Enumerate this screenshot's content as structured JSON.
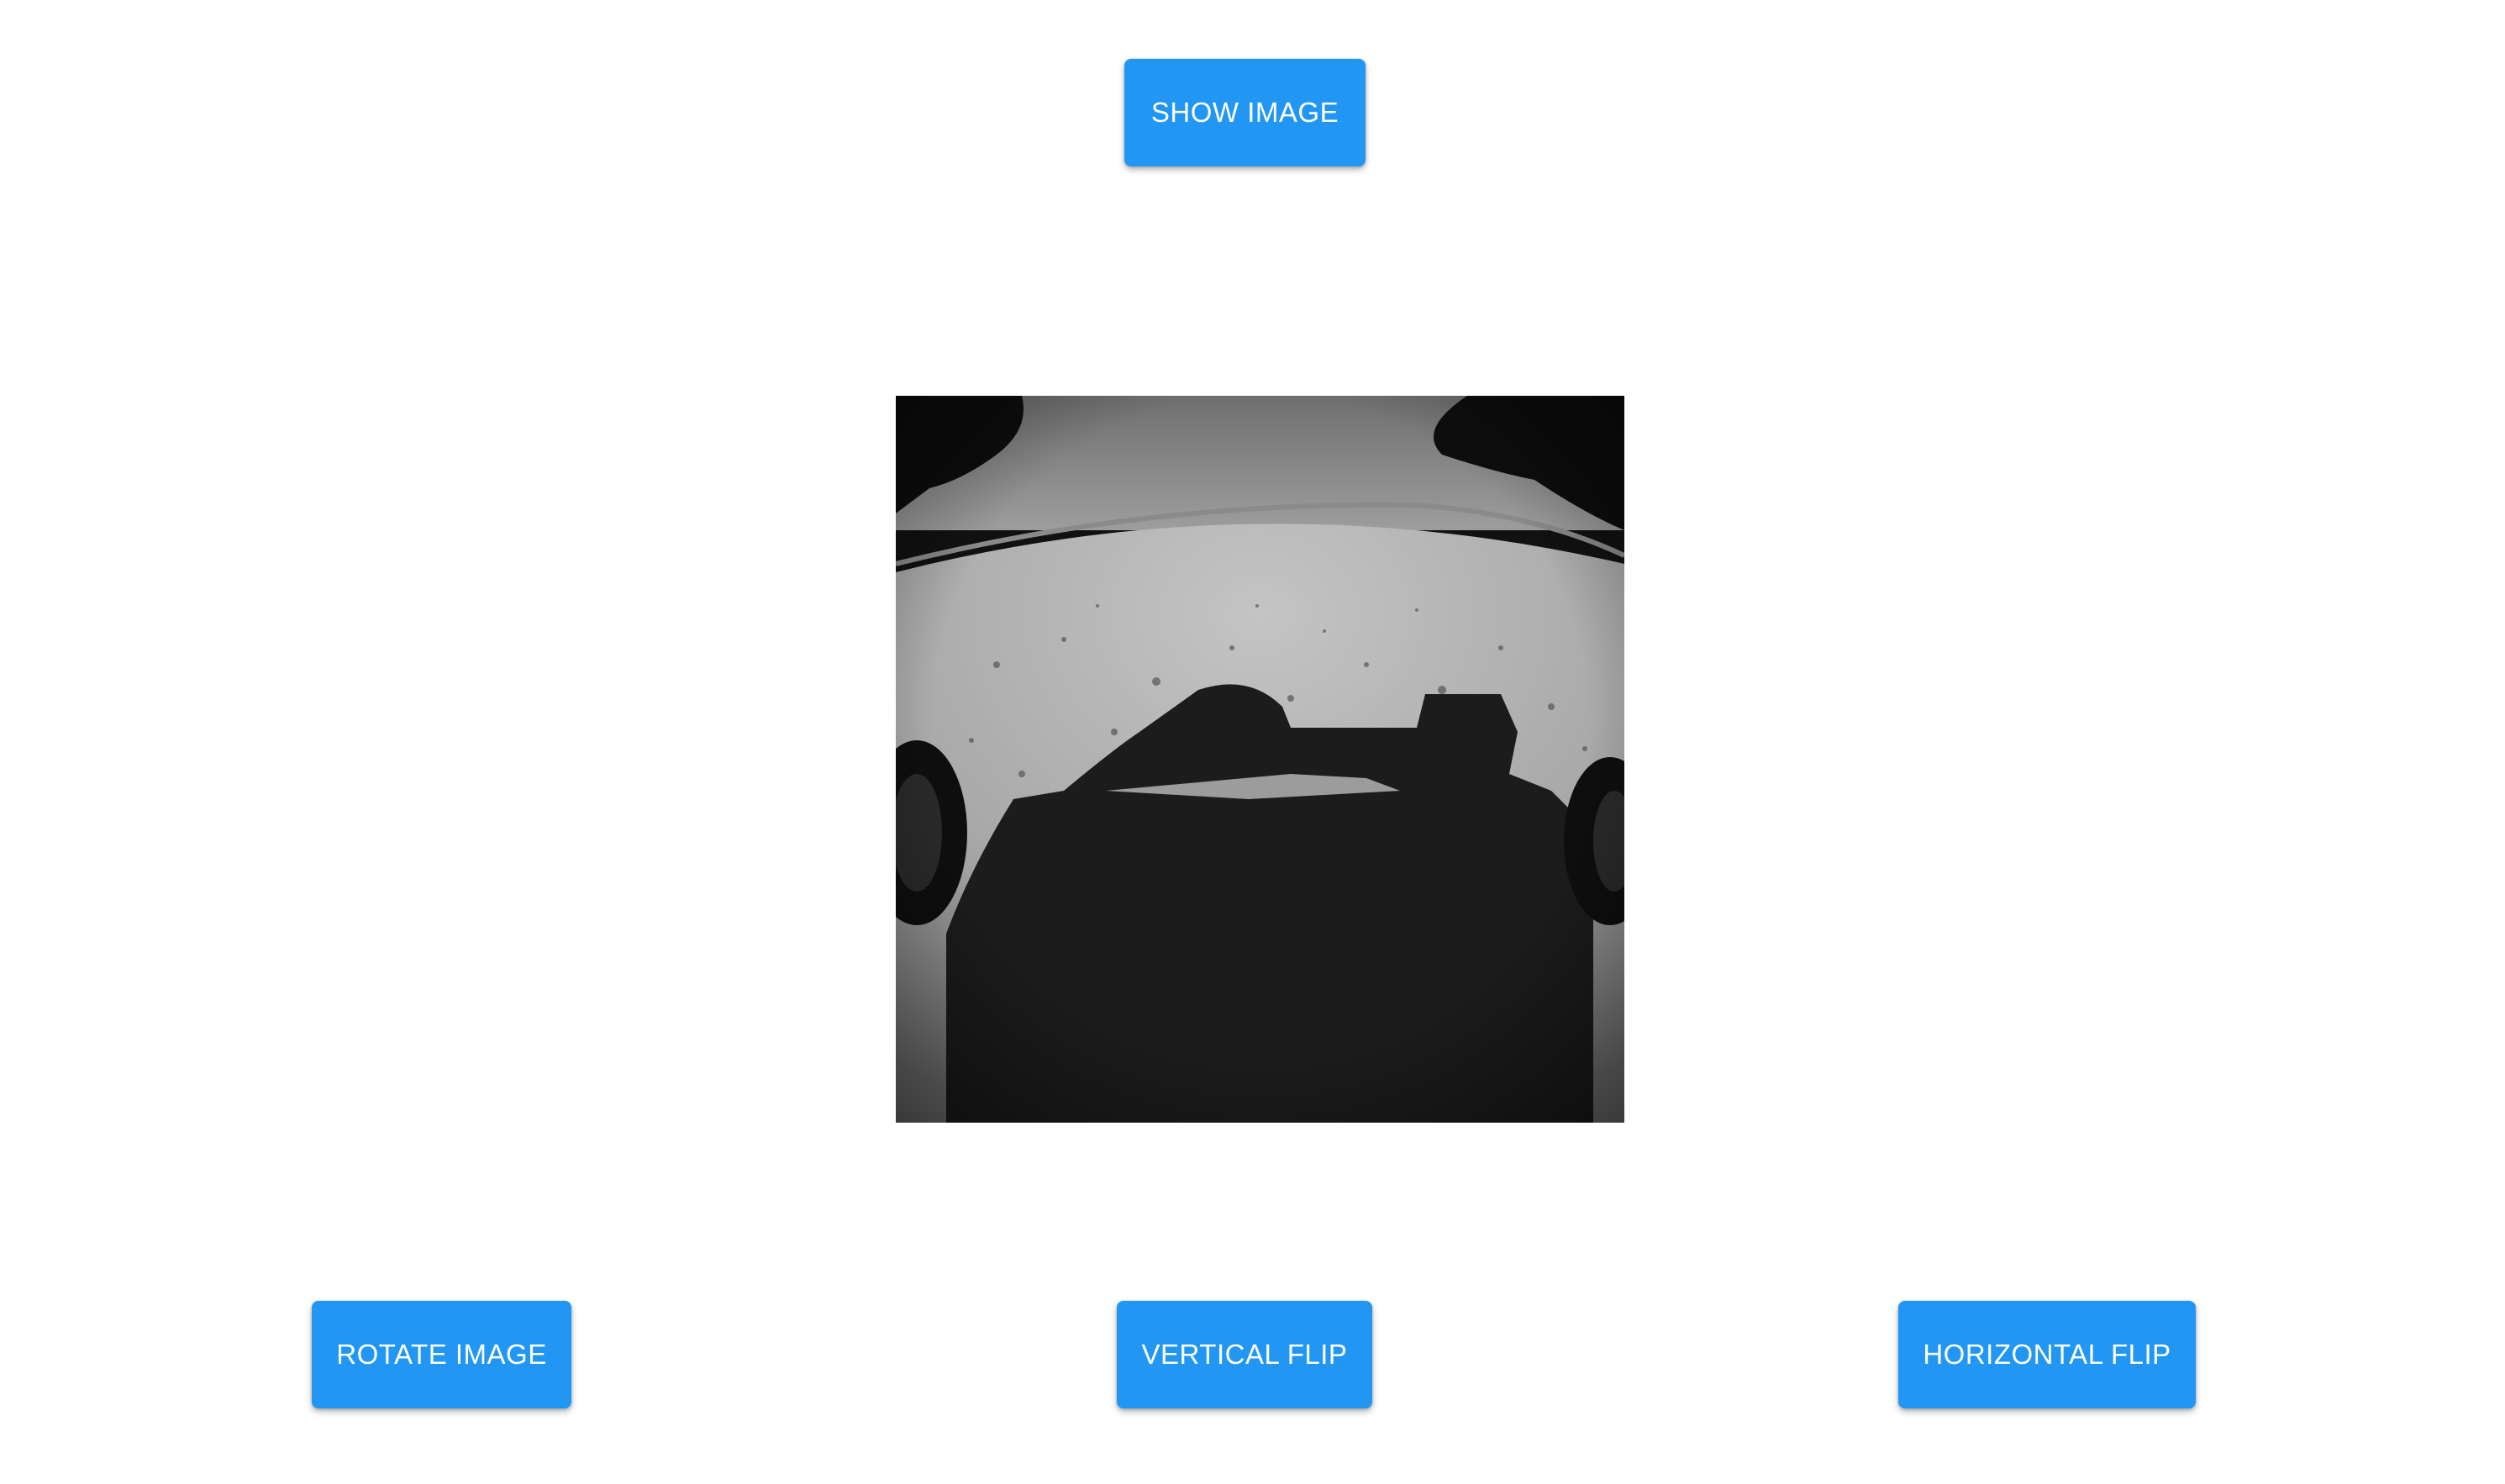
{
  "buttons": {
    "show_image": "SHOW IMAGE",
    "rotate_image": "ROTATE IMAGE",
    "vertical_flip": "VERTICAL FLIP",
    "horizontal_flip": "HORIZONTAL FLIP"
  },
  "colors": {
    "button_background": "#2196f3",
    "button_text": "#ffffff",
    "page_background": "#ffffff"
  }
}
